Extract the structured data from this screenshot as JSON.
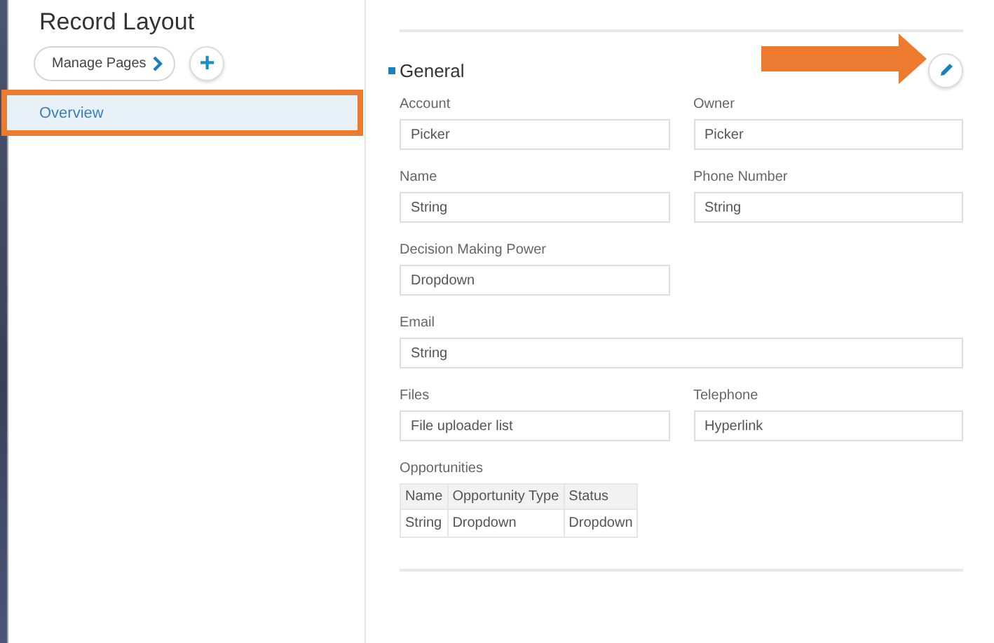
{
  "sidebar": {
    "title": "Record Layout",
    "manage_button": "Manage Pages",
    "add_button": "+",
    "items": [
      {
        "label": "Overview",
        "selected": true,
        "highlighted": true
      }
    ]
  },
  "section": {
    "title": "General",
    "edit_callout": true,
    "fields": [
      {
        "kind": "half",
        "label": "Account",
        "value": "Picker"
      },
      {
        "kind": "half",
        "label": "Owner",
        "value": "Picker"
      },
      {
        "kind": "half",
        "label": "Name",
        "value": "String"
      },
      {
        "kind": "half",
        "label": "Phone Number",
        "value": "String"
      },
      {
        "kind": "half",
        "label": "Decision Making Power",
        "value": "Dropdown"
      },
      {
        "kind": "full",
        "label": "Email",
        "value": "String"
      },
      {
        "kind": "half",
        "label": "Files",
        "value": "File uploader list"
      },
      {
        "kind": "half",
        "label": "Telephone",
        "value": "Hyperlink"
      },
      {
        "kind": "table",
        "label": "Opportunities",
        "columns": [
          "Name",
          "Opportunity Type",
          "Status"
        ],
        "rows": [
          [
            "String",
            "Dropdown",
            "Dropdown"
          ]
        ]
      }
    ]
  }
}
